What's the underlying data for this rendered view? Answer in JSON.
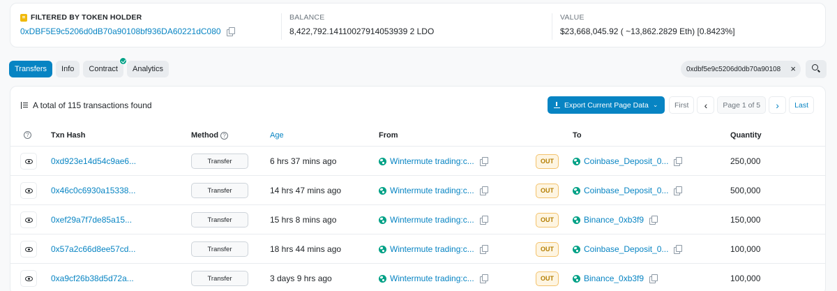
{
  "summary_card": {
    "filter": {
      "label": "FILTERED BY TOKEN HOLDER",
      "address": "0xDBF5E9c5206d0dB70a90108bf936DA60221dC080"
    },
    "balance": {
      "label": "BALANCE",
      "value": "8,422,792.14110027914053939 2 LDO"
    },
    "value": {
      "label": "VALUE",
      "value": "$23,668,045.92 ( ~13,862.2829 Eth) [0.8423%]"
    }
  },
  "tabs": [
    {
      "label": "Transfers",
      "active": true
    },
    {
      "label": "Info",
      "active": false
    },
    {
      "label": "Contract",
      "active": false,
      "verified": true
    },
    {
      "label": "Analytics",
      "active": false
    }
  ],
  "address_filter": {
    "value": "0xdbf5e9c5206d0db70a90108",
    "close": "×"
  },
  "table_summary": "A total of 115 transactions found",
  "export_label": "Export Current Page Data",
  "pager": {
    "first": "First",
    "prev": "‹",
    "page_label": "Page 1 of 5",
    "next": "›",
    "last": "Last"
  },
  "columns": {
    "txn_hash": "Txn Hash",
    "method": "Method",
    "age": "Age",
    "from": "From",
    "to": "To",
    "quantity": "Quantity"
  },
  "rows": [
    {
      "hash": "0xd923e14d54c9ae6...",
      "method": "Transfer",
      "age": "6 hrs 37 mins ago",
      "from": "Wintermute trading:c...",
      "direction": "OUT",
      "to": "Coinbase_Deposit_0...",
      "to_has_copy": true,
      "quantity": "250,000"
    },
    {
      "hash": "0x46c0c6930a15338...",
      "method": "Transfer",
      "age": "14 hrs 47 mins ago",
      "from": "Wintermute trading:c...",
      "direction": "OUT",
      "to": "Coinbase_Deposit_0...",
      "to_has_copy": true,
      "quantity": "500,000"
    },
    {
      "hash": "0xef29a7f7de85a15...",
      "method": "Transfer",
      "age": "15 hrs 8 mins ago",
      "from": "Wintermute trading:c...",
      "direction": "OUT",
      "to": "Binance_0xb3f9",
      "to_has_copy": true,
      "quantity": "150,000"
    },
    {
      "hash": "0x57a2c66d8ee57cd...",
      "method": "Transfer",
      "age": "18 hrs 44 mins ago",
      "from": "Wintermute trading:c...",
      "direction": "OUT",
      "to": "Coinbase_Deposit_0...",
      "to_has_copy": true,
      "quantity": "100,000"
    },
    {
      "hash": "0xa9cf26b38d5d72a...",
      "method": "Transfer",
      "age": "3 days 9 hrs ago",
      "from": "Wintermute trading:c...",
      "direction": "OUT",
      "to": "Binance_0xb3f9",
      "to_has_copy": true,
      "quantity": "100,000"
    }
  ],
  "colors": {
    "accent": "#0784c3",
    "out_badge_bg": "#fef5e2",
    "out_badge_text": "#b47d00",
    "verified": "#00a186",
    "filter_icon": "#f0b90b"
  }
}
